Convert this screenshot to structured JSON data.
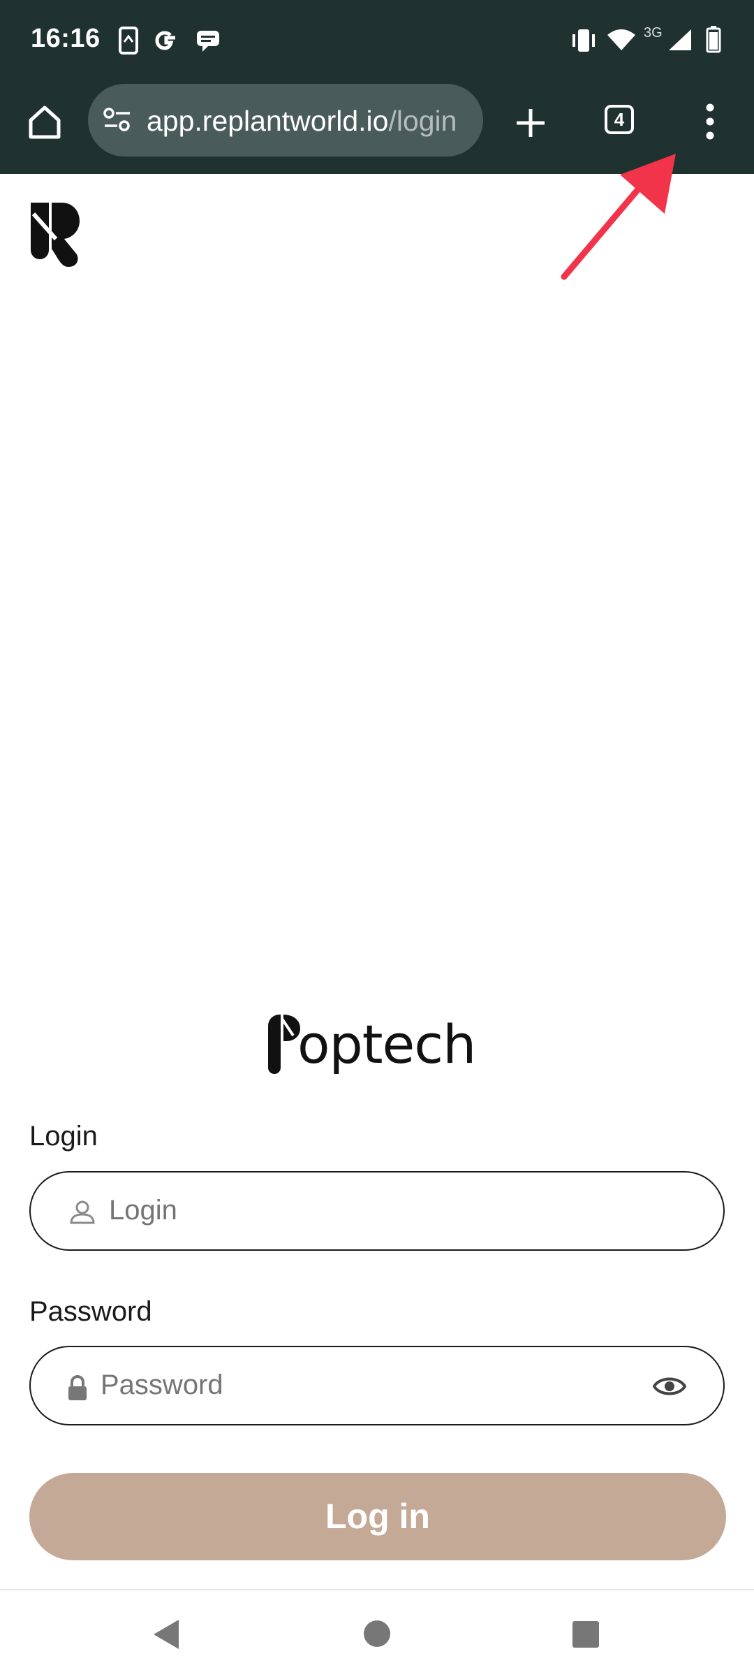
{
  "status_bar": {
    "time": "16:16",
    "network_label": "3G",
    "icons": [
      "screen-share-icon",
      "google-icon",
      "message-icon",
      "vibrate-icon",
      "wifi-icon",
      "signal-icon",
      "battery-icon"
    ]
  },
  "browser": {
    "url_host": "app.replantworld.io",
    "url_path": "/login",
    "tab_count": "4",
    "icons": [
      "home-icon",
      "site-settings-icon",
      "new-tab-icon",
      "tab-switcher-icon",
      "more-menu-icon"
    ]
  },
  "annotation": {
    "color": "#f2344a",
    "icon": "red-arrow-pointing-to-menu"
  },
  "page": {
    "brand": "optech",
    "login_label": "Login",
    "login_placeholder": "Login",
    "password_label": "Password",
    "password_placeholder": "Password",
    "login_button": "Log in",
    "button_color": "#c4aa96"
  },
  "nav_bar": {
    "icons": [
      "back-icon",
      "home-circle-icon",
      "recents-icon"
    ]
  },
  "colors": {
    "browser_bar": "#1f3230",
    "url_pill": "#4a5c5a"
  }
}
